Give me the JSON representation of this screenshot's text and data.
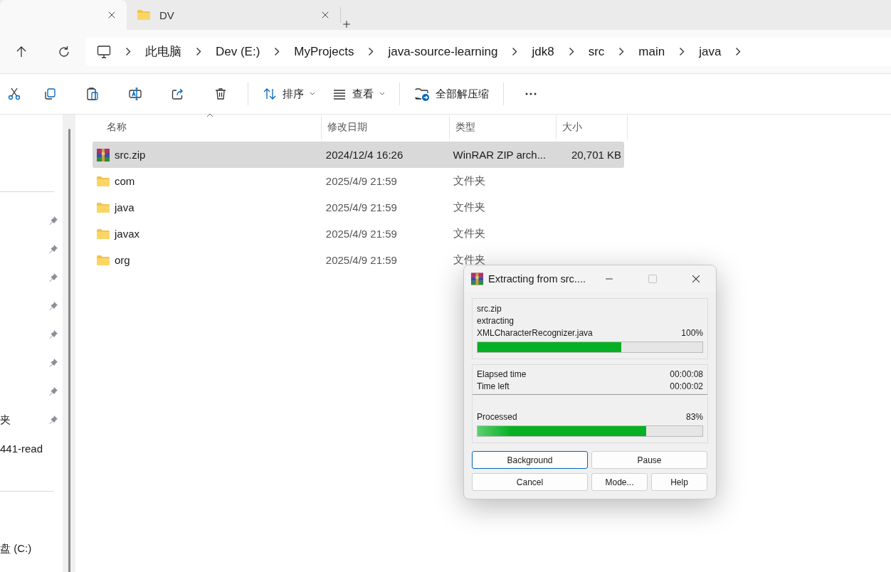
{
  "tabs": [
    {
      "selected": true
    },
    {
      "label": "DV",
      "selected": false
    }
  ],
  "breadcrumb": [
    "此电脑",
    "Dev (E:)",
    "MyProjects",
    "java-source-learning",
    "jdk8",
    "src",
    "main",
    "java"
  ],
  "toolbar": {
    "sort_label": "排序",
    "view_label": "查看",
    "extract_label": "全部解压缩"
  },
  "sidebar": {
    "pinned_items": [
      {
        "pinned": true
      },
      {
        "pinned": true
      },
      {
        "pinned": true
      },
      {
        "pinned": true
      },
      {
        "pinned": true
      },
      {
        "pinned": true
      },
      {
        "pinned": true
      },
      {
        "label": "夹",
        "pinned": true
      },
      {
        "label": "441-read",
        "pinned": false
      }
    ],
    "drives": [
      {
        "label": "盘 (C:)"
      }
    ]
  },
  "table": {
    "columns": [
      {
        "label": "名称",
        "sorted": true
      },
      {
        "label": "修改日期",
        "sorted": false
      },
      {
        "label": "类型",
        "sorted": false
      },
      {
        "label": "大小",
        "sorted": false
      }
    ],
    "rows": [
      {
        "kind": "archive",
        "name": "src.zip",
        "modified": "2024/12/4 16:26",
        "type": "WinRAR ZIP arch...",
        "size": "20,701 KB",
        "selected": true
      },
      {
        "kind": "folder",
        "name": "com",
        "modified": "2025/4/9 21:59",
        "type": "文件夹",
        "selected": false
      },
      {
        "kind": "folder",
        "name": "java",
        "modified": "2025/4/9 21:59",
        "type": "文件夹",
        "selected": false
      },
      {
        "kind": "folder",
        "name": "javax",
        "modified": "2025/4/9 21:59",
        "type": "文件夹",
        "selected": false
      },
      {
        "kind": "folder",
        "name": "org",
        "modified": "2025/4/9 21:59",
        "type": "文件夹",
        "selected": false
      }
    ]
  },
  "dialog": {
    "title": "Extracting from src....",
    "archive": "src.zip",
    "action": "extracting",
    "file": "XMLCharacterRecognizer.java",
    "file_percent": "100%",
    "file_progress": {
      "level": 0.64
    },
    "elapsed_label": "Elapsed time",
    "elapsed": "00:00:08",
    "left_label": "Time left",
    "left": "00:00:02",
    "processed_label": "Processed",
    "processed_percent": "83%",
    "processed_progress": {
      "level": 0.75
    },
    "maximize_disabled": true,
    "buttons": [
      {
        "label": "Background",
        "focused": true
      },
      {
        "label": "Pause",
        "focused": false
      },
      {
        "label": "Cancel",
        "focused": false
      },
      {
        "label": "Mode...",
        "focused": false
      },
      {
        "label": "Help",
        "focused": false
      }
    ]
  }
}
